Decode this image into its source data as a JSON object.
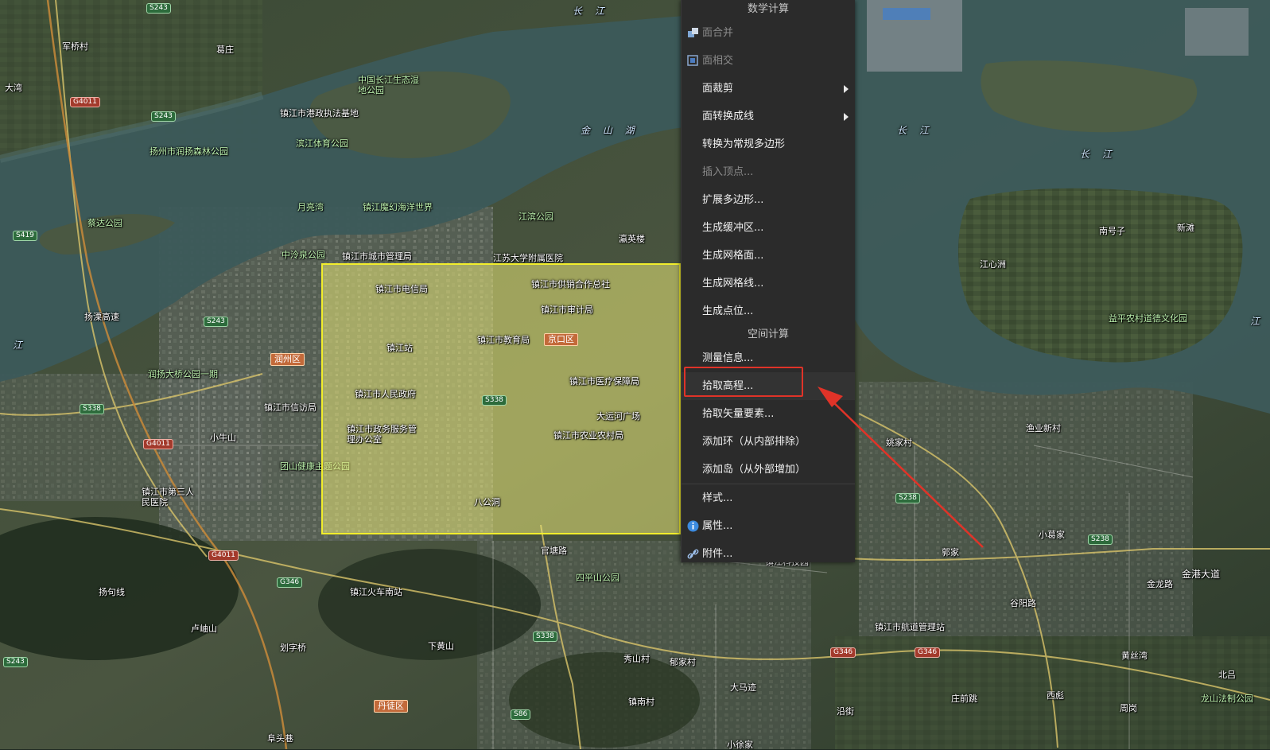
{
  "map": {
    "water_labels": {
      "changjiang_1": "长 江",
      "changjiang_2": "长 江",
      "changjiang_3": "长 江",
      "jinshan_lake": "金 山 湖",
      "jiang_left": "江",
      "jiang_right": "江"
    },
    "places": {
      "junqiao": "军桥村",
      "gezhuang": "葛庄",
      "dawan": "大湾",
      "zhenjiang_port": "镇江市港政执法基地",
      "binjiang_park": "滨江体育公园",
      "yangzhou_forest": "扬州市润扬森林公园",
      "yueliangwan": "月亮湾",
      "zhenjiang_ocean": "镇江魔幻海洋世界",
      "cailu_park": "蔡达公园",
      "zhongleng_park": "中泠泉公园",
      "city_mgmt": "镇江市城市管理局",
      "jiangsu_hospital": "江苏大学附属医院",
      "jiangbin_park": "江滨公园",
      "yingying": "瀛英楼",
      "changjiang_eco": "中国长江生态湿地公园",
      "runzhou_park": "润扬大桥公园一期",
      "xinfang": "镇江市信访局",
      "xiaoniushan": "小牛山",
      "tuanshan_park": "团山健康主题公园",
      "third_hospital": "镇江市第三人民医院",
      "lujiashan": "卢岫山",
      "liuzi": "划字桥",
      "xiahuangshan": "下黄山",
      "xiushan": "秀山村",
      "yujia": "郁家村",
      "sipingshan": "四平山公园",
      "railway_south": "镇江火车南站",
      "zhennan": "镇南村",
      "damaji": "大马迹",
      "fuqiao": "阜头巷",
      "xiaoyi": "小徐家",
      "yanjie": "沿街",
      "zhuangqian": "庄前跳",
      "xipo": "西彪",
      "zhougang": "周岗",
      "beilv": "北吕",
      "longshan": "龙山法制公园",
      "huangsiwan": "黄丝湾",
      "hangdao": "镇江市航道管理站",
      "xiaogejia": "小葛家",
      "guojia": "郭家",
      "yaojia": "姚家村",
      "yuye": "渔业新村",
      "jiangxinzhou": "江心洲",
      "nanhaozi": "南号子",
      "xintan": "新滩",
      "yiping_park": "益平农村道德文化园",
      "jingang_road": "金港大道",
      "gutang_road": "谷阳路",
      "jinlong_road": "金龙路",
      "guanhu_road": "官塘路",
      "yangwu": "扬溧高速",
      "yangju": "扬句线",
      "jingkou": "京口区",
      "runzhou": "润州区",
      "dantu": "丹徒区",
      "zhenjiang_science": "镇江科技园"
    },
    "shields": {
      "s243a": "S243",
      "s243b": "S243",
      "s243c": "S243",
      "s243d": "S243",
      "g4011a": "G4011",
      "g4011b": "G4011",
      "g4011c": "G4011",
      "s419": "S419",
      "s338a": "S338",
      "s338b": "S338",
      "s338c": "S338",
      "g346a": "G346",
      "g346b": "G346",
      "g346c": "G346",
      "s238a": "S238",
      "s238b": "S238",
      "s86": "S86"
    },
    "selection_places": {
      "dianxin": "镇江市电信局",
      "gongxiao": "镇江市供销合作总社",
      "shenji": "镇江市审计局",
      "zhenjiang_station": "镇江站",
      "jiaoyu": "镇江市教育局",
      "jingkou_badge": "京口区",
      "yibao": "镇江市医疗保障局",
      "renmin": "镇江市人民政府",
      "s338": "S338",
      "grand_canal": "大运河广场",
      "zhengwu": "镇江市政务服务管理办公室",
      "nongye": "镇江市农业农村局",
      "bagongdong": "八公洞"
    }
  },
  "context_menu": {
    "section_math": "数学计算",
    "section_spatial": "空间计算",
    "items": [
      {
        "label": "面合并",
        "enabled": false,
        "icon": "merge-icon"
      },
      {
        "label": "面相交",
        "enabled": false,
        "icon": "intersect-icon"
      },
      {
        "label": "面裁剪",
        "enabled": true,
        "submenu": true
      },
      {
        "label": "面转换成线",
        "enabled": true,
        "submenu": true
      },
      {
        "label": "转换为常规多边形",
        "enabled": true
      },
      {
        "label": "插入顶点...",
        "enabled": false
      },
      {
        "label": "扩展多边形...",
        "enabled": true
      },
      {
        "label": "生成缓冲区...",
        "enabled": true
      },
      {
        "label": "生成网格面...",
        "enabled": true
      },
      {
        "label": "生成网格线...",
        "enabled": true
      },
      {
        "label": "生成点位...",
        "enabled": true
      }
    ],
    "spatial_items": [
      {
        "label": "测量信息...",
        "enabled": true
      },
      {
        "label": "拾取高程...",
        "enabled": true,
        "highlighted": true
      },
      {
        "label": "拾取矢量要素...",
        "enabled": true
      },
      {
        "label": "添加环（从内部排除）",
        "enabled": true
      },
      {
        "label": "添加岛（从外部增加）",
        "enabled": true
      },
      {
        "label": "样式...",
        "enabled": true
      },
      {
        "label": "属性...",
        "enabled": true,
        "icon": "info-icon"
      },
      {
        "label": "附件...",
        "enabled": true,
        "icon": "link-icon"
      }
    ]
  },
  "annotation": {
    "highlight_color": "#e03328",
    "arrow_color": "#e03328"
  }
}
